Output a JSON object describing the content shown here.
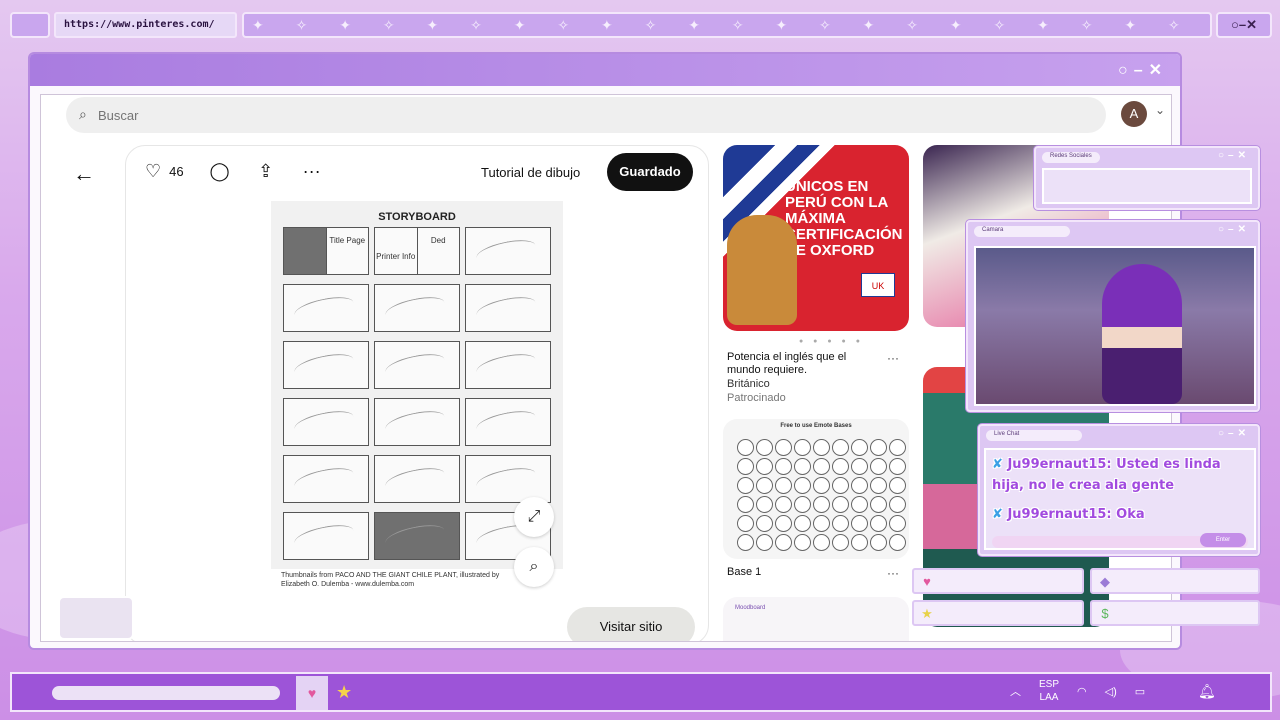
{
  "browser": {
    "url": "https://www.pinteres.com/",
    "sparkles": "✦ ✧ ✦ ✧ ✦ ✧ ✦ ✧ ✦ ✧ ✦ ✧ ✦ ✧ ✦ ✧ ✦ ✧ ✦ ✧ ✦ ✧ ✦ ✧ ✦ ✧ ✦ ✧",
    "controls": "○–✕"
  },
  "window": {
    "controls": "○–✕"
  },
  "search": {
    "placeholder": "Buscar"
  },
  "user": {
    "avatar_letter": "A"
  },
  "pin": {
    "likes": "46",
    "board_name": "Tutorial de dibujo",
    "saved_label": "Guardado",
    "storyboard_title": "STORYBOARD",
    "panel_title": "Title Page",
    "panel_printer": "Printer Info",
    "panel_ded": "Ded",
    "caption": "Thumbnails from PACO AND THE GIANT CHILE PLANT, illustrated by Elizabeth O. Dulemba - www.dulemba.com",
    "visit_label": "Visitar sitio"
  },
  "feed": {
    "ad": {
      "headline": "Únicos en Perú con la máxima certificación de Oxford",
      "flag_label": "UK",
      "title": "Potencia el inglés que el mundo requiere.",
      "brand": "Británico",
      "sponsored": "Patrocinado"
    },
    "emote": {
      "image_title": "Free to use Emote Bases",
      "title": "Base 1"
    },
    "moodboard": {
      "label": "Moodboard"
    },
    "more": "···"
  },
  "overlays": {
    "social": {
      "title": "Redes Sociales"
    },
    "camera": {
      "title": "Camara"
    },
    "chat": {
      "title": "Live Chat",
      "messages": [
        {
          "user": "Ju99ernaut15:",
          "text": "Usted es linda hija, no le crea ala gente"
        },
        {
          "user": "Ju99ernaut15:",
          "text": "Oka"
        }
      ],
      "enter_label": "Enter"
    }
  },
  "taskbar": {
    "lang_top": "ESP",
    "lang_bottom": "LAA"
  },
  "colors": {
    "accent": "#9d54d8",
    "overlay": "#ddc7f3",
    "chat_text": "#a24bdf"
  }
}
